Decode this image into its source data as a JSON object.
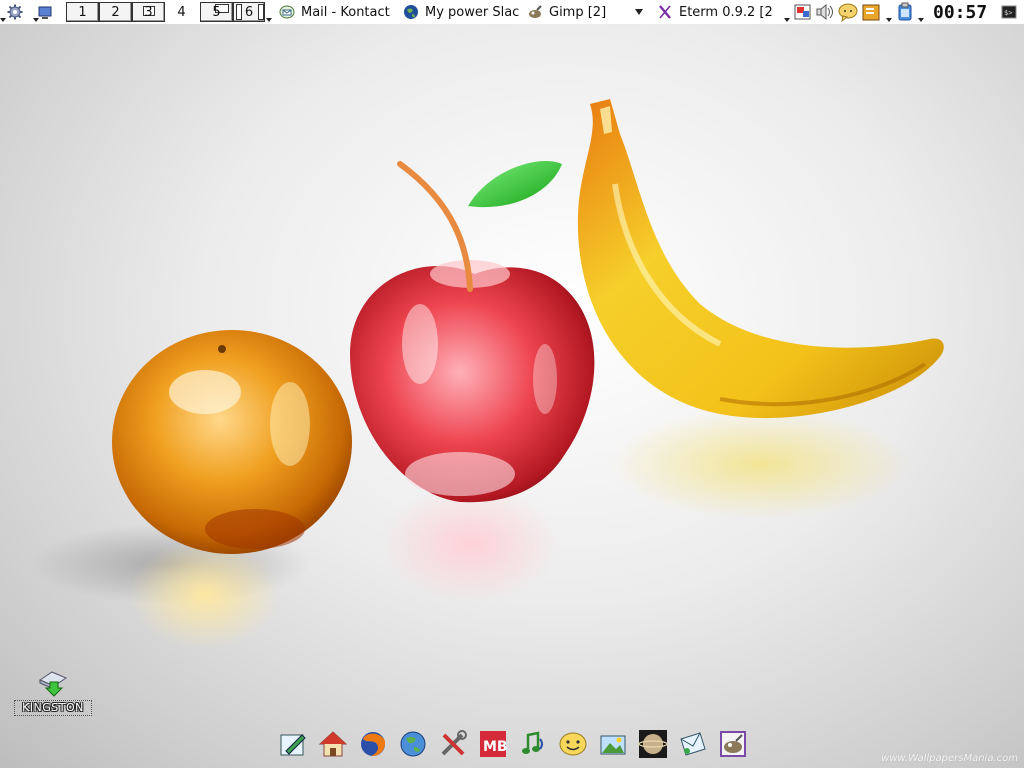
{
  "top_panel": {
    "pager": {
      "desktops": [
        "1",
        "2",
        "3",
        "4",
        "5",
        "6"
      ]
    },
    "tasks": [
      {
        "label": "Mail - Kontact",
        "icon": "kontact-mail-icon"
      },
      {
        "label": "My power Slac",
        "icon": "globe-icon"
      },
      {
        "label": "Gimp [2]",
        "icon": "gimp-icon"
      },
      {
        "label": "Eterm 0.9.2 [2",
        "icon": "eterm-x-icon"
      }
    ],
    "clock": "00:57"
  },
  "desktop": {
    "icons": [
      {
        "label": "KINGSTON",
        "icon": "usb-drive-icon"
      }
    ]
  },
  "dock": {
    "items": [
      {
        "icon": "editor-icon"
      },
      {
        "icon": "home-folder-icon"
      },
      {
        "icon": "firefox-icon"
      },
      {
        "icon": "globe-browser-icon"
      },
      {
        "icon": "tools-settings-icon"
      },
      {
        "icon": "mb-app-icon"
      },
      {
        "icon": "music-player-icon"
      },
      {
        "icon": "messenger-smiley-icon"
      },
      {
        "icon": "image-viewer-icon"
      },
      {
        "icon": "planet-icon"
      },
      {
        "icon": "mail-client-icon"
      },
      {
        "icon": "gimp-dock-icon"
      }
    ]
  },
  "wallpaper": {
    "watermark": "www.WallpapersMania.com"
  },
  "colors": {
    "panel_bg": "#ffffff",
    "eterm_purple": "#7a2fa8",
    "orange_fruit": "#f0a020",
    "apple_red": "#e8303c",
    "banana_yellow": "#f3c21a",
    "leaf_green": "#2ec42e"
  }
}
